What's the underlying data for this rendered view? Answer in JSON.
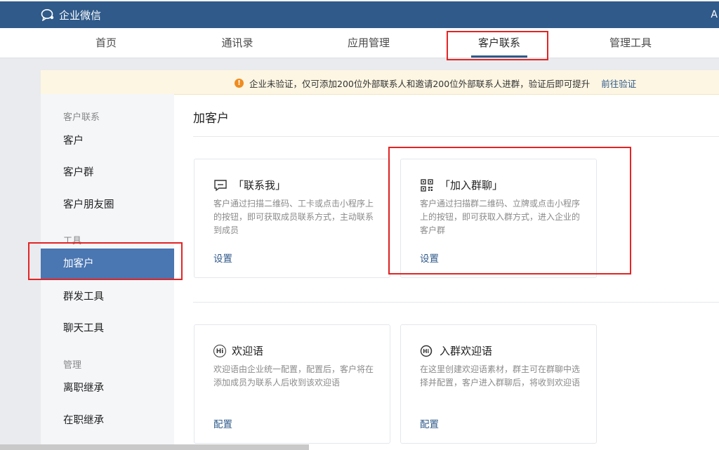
{
  "app": {
    "name": "企业微信",
    "top_right": "A"
  },
  "nav": {
    "items": [
      {
        "label": "首页"
      },
      {
        "label": "通讯录"
      },
      {
        "label": "应用管理"
      },
      {
        "label": "客户联系"
      },
      {
        "label": "管理工具"
      }
    ],
    "active": "客户联系"
  },
  "notice": {
    "text": "企业未验证，仅可添加200位外部联系人和邀请200位外部联系人进群，验证后即可提升",
    "link": "前往验证",
    "icon": "warning-icon",
    "color": "#f08c1e"
  },
  "sidebar": {
    "groups": [
      {
        "label": "客户联系",
        "items": [
          "客户",
          "客户群",
          "客户朋友圈"
        ]
      },
      {
        "label": "工具",
        "items": [
          "加客户",
          "群发工具",
          "聊天工具"
        ]
      },
      {
        "label": "管理",
        "items": [
          "离职继承",
          "在职继承"
        ]
      }
    ],
    "active": "加客户"
  },
  "main": {
    "title": "加客户",
    "cards": [
      {
        "icon": "chat-bubble-icon",
        "title": "「联系我」",
        "desc": "客户通过扫描二维码、工卡或点击小程序上的按钮，即可获取成员联系方式，主动联系到成员",
        "action": "设置"
      },
      {
        "icon": "qrcode-icon",
        "title": "「加入群聊」",
        "desc": "客户通过扫描群二维码、立牌或点击小程序上的按钮，即可获取入群方式，进入企业的客户群",
        "action": "设置"
      },
      {
        "icon": "hi-icon",
        "title": "欢迎语",
        "desc": "欢迎语由企业统一配置，配置后，客户将在添加成员为联系人后收到该欢迎语",
        "action": "配置"
      },
      {
        "icon": "hi-group-icon",
        "title": "入群欢迎语",
        "desc": "在这里创建欢迎语素材，群主可在群聊中选择并配置，客户进入群聊后，将收到欢迎语",
        "action": "配置"
      }
    ]
  },
  "colors": {
    "brand": "#2f5a8a",
    "active_side": "#4a76b2",
    "highlight": "#e32424"
  }
}
